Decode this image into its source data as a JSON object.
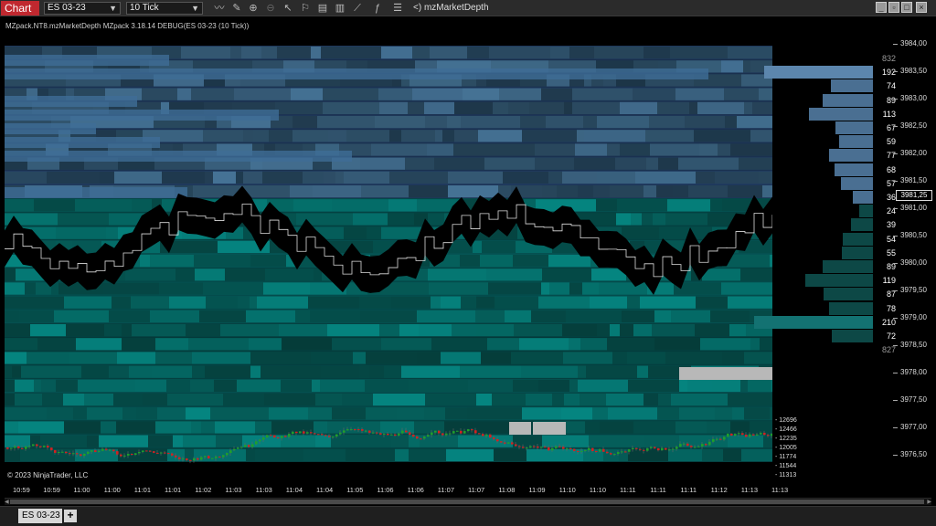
{
  "toolbar": {
    "chart_tab": "Chart",
    "instrument": "ES 03-23",
    "interval": "10 Tick",
    "indicator": "<)  mzMarketDepth",
    "icons": [
      "line-icon",
      "pencil-icon",
      "zoom-in-icon",
      "zoom-out-icon",
      "cursor-icon",
      "strategy-icon",
      "data-box-icon",
      "bar-chart-icon",
      "drawing-icon",
      "indicator-icon",
      "properties-icon"
    ]
  },
  "info_line": "MZpack.NT8.mzMarketDepth MZpack 3.18.14 DEBUG(ES 03-23 (10 Tick))",
  "copyright": "© 2023 NinjaTrader, LLC",
  "price_axis": {
    "labels": [
      "3984,00",
      "3983,50",
      "3983,00",
      "3982,50",
      "3982,00",
      "3981,50",
      "3981,00",
      "3980,50",
      "3980,00",
      "3979,50",
      "3979,00",
      "3978,50",
      "3978,00",
      "3977,50",
      "3977,00",
      "3976,50"
    ],
    "last_price": "3981,25"
  },
  "dom": [
    {
      "value": "832",
      "level": 0,
      "type": "total-ask"
    },
    {
      "value": "192",
      "level": 1,
      "type": "ask-hot"
    },
    {
      "value": "74",
      "level": 2,
      "type": "ask"
    },
    {
      "value": "89",
      "level": 3,
      "type": "ask"
    },
    {
      "value": "113",
      "level": 4,
      "type": "ask"
    },
    {
      "value": "67",
      "level": 5,
      "type": "ask"
    },
    {
      "value": "59",
      "level": 6,
      "type": "ask"
    },
    {
      "value": "77",
      "level": 7,
      "type": "ask"
    },
    {
      "value": "68",
      "level": 8,
      "type": "ask"
    },
    {
      "value": "57",
      "level": 9,
      "type": "ask"
    },
    {
      "value": "36",
      "level": 10,
      "type": "ask"
    },
    {
      "value": "24",
      "level": 11,
      "type": "bid"
    },
    {
      "value": "39",
      "level": 12,
      "type": "bid"
    },
    {
      "value": "54",
      "level": 13,
      "type": "bid"
    },
    {
      "value": "55",
      "level": 14,
      "type": "bid"
    },
    {
      "value": "89",
      "level": 15,
      "type": "bid"
    },
    {
      "value": "119",
      "level": 16,
      "type": "bid"
    },
    {
      "value": "87",
      "level": 17,
      "type": "bid"
    },
    {
      "value": "78",
      "level": 18,
      "type": "bid"
    },
    {
      "value": "210",
      "level": 19,
      "type": "bid-hot"
    },
    {
      "value": "72",
      "level": 20,
      "type": "bid"
    },
    {
      "value": "827",
      "level": 21,
      "type": "total-bid"
    }
  ],
  "volume_labels": [
    "12696",
    "12466",
    "12235",
    "12005",
    "11774",
    "11544",
    "11313"
  ],
  "time_labels": [
    "10:59",
    "10:59",
    "11:00",
    "11:00",
    "11:01",
    "11:01",
    "11:02",
    "11:03",
    "11:03",
    "11:04",
    "11:04",
    "11:05",
    "11:06",
    "11:06",
    "11:07",
    "11:07",
    "11:08",
    "11:09",
    "11:10",
    "11:10",
    "11:11",
    "11:11",
    "11:11",
    "11:12",
    "11:13",
    "11:13"
  ],
  "bottom": {
    "tab": "ES 03-23",
    "add": "+"
  },
  "colors": {
    "ask": "#4a6f92",
    "ask_hot": "#5c86ad",
    "bid": "#0d4846",
    "bid_hot": "#137272",
    "up_candle": "#1fa02a",
    "down_candle": "#d42020",
    "chart_tab": "#c0282f"
  }
}
